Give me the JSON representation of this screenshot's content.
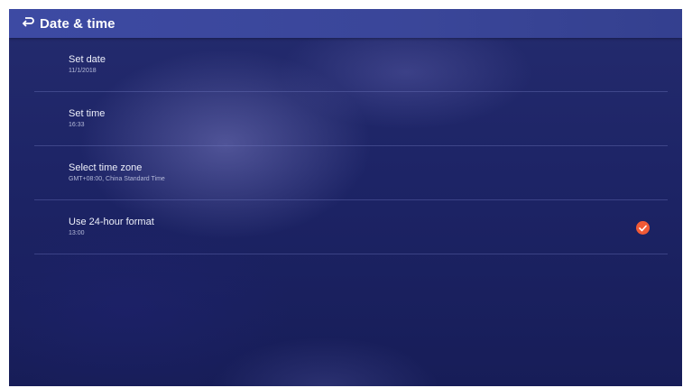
{
  "header": {
    "title": "Date & time",
    "back_icon": "back-arrow-icon"
  },
  "settings": {
    "items": [
      {
        "title": "Set date",
        "subtitle": "11/1/2018"
      },
      {
        "title": "Set time",
        "subtitle": "16:33"
      },
      {
        "title": "Select time zone",
        "subtitle": "GMT+08:00, China Standard Time"
      },
      {
        "title": "Use 24-hour format",
        "subtitle": "13:00",
        "checked": true
      }
    ]
  },
  "colors": {
    "accent": "#f15a36",
    "appbar": "#3d4aa3",
    "background": "#1d2466"
  }
}
